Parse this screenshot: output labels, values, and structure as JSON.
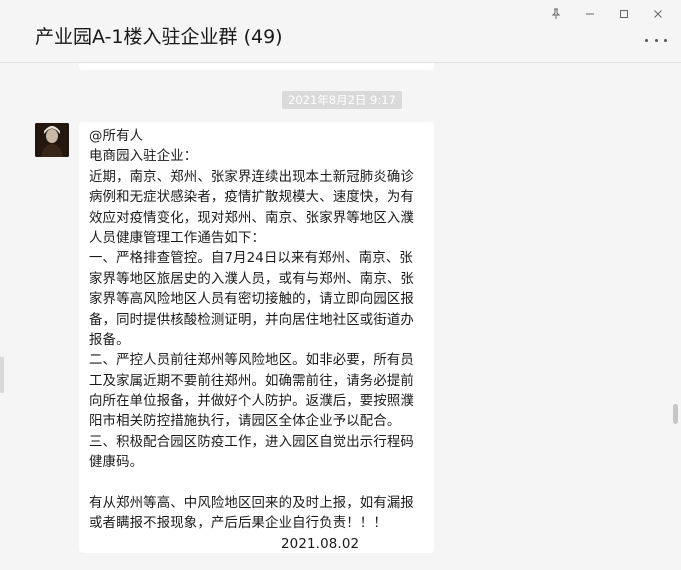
{
  "window": {
    "title": "产业园A-1楼入驻企业群 (49)",
    "controls": {
      "pin": "⚲",
      "minimize": "—",
      "maximize": "☐",
      "close": "✕"
    },
    "more_icon": "more-dots-icon"
  },
  "chat": {
    "timestamp": "2021年8月2日 9:17",
    "message": {
      "lines": [
        "@所有人",
        "电商园入驻企业：",
        "近期，南京、郑州、张家界连续出现本土新冠肺炎确诊",
        "病例和无症状感染者，疫情扩散规模大、速度快，为有",
        "效应对疫情变化，现对郑州、南京、张家界等地区入濮",
        "人员健康管理工作通告如下：",
        "一、严格排查管控。自7月24日以来有郑州、南京、张",
        "家界等地区旅居史的入濮人员，或有与郑州、南京、张",
        "家界等高风险地区人员有密切接触的，请立即向园区报",
        "备，同时提供核酸检测证明，并向居住地社区或街道办",
        "报备。",
        "二、严控人员前往郑州等风险地区。如非必要，所有员",
        "工及家属近期不要前往郑州。如确需前往，请务必提前",
        "向所在单位报备，并做好个人防护。返濮后，要按照濮",
        "阳市相关防控措施执行，请园区全体企业予以配合。",
        "三、积极配合园区防疫工作，进入园区自觉出示行程码",
        "健康码。",
        "",
        "有从郑州等高、中风险地区回来的及时上报，如有漏报",
        "或者瞒报不报现象，产后后果企业自行负责！！！"
      ],
      "date": "2021.08.02"
    }
  }
}
